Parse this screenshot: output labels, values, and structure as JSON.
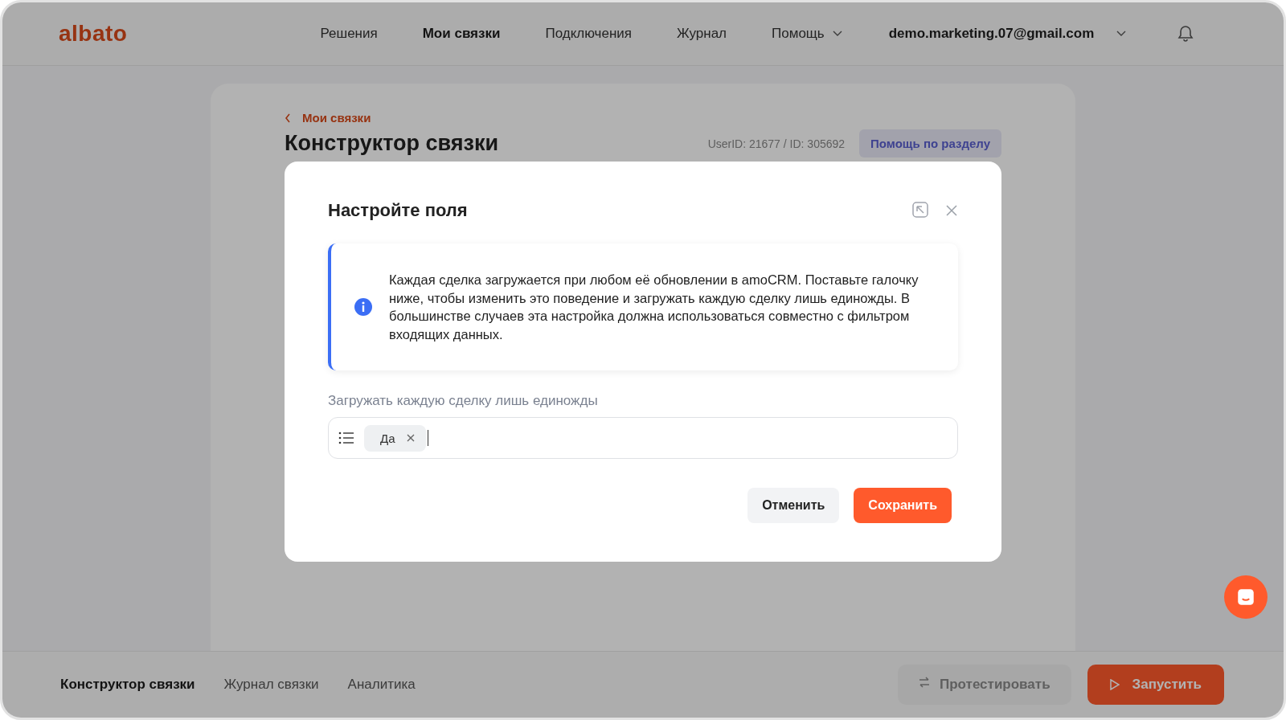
{
  "header": {
    "logo": "albato",
    "nav": [
      {
        "label": "Решения",
        "selected": false,
        "dropdown": false
      },
      {
        "label": "Мои связки",
        "selected": true,
        "dropdown": false
      },
      {
        "label": "Подключения",
        "selected": false,
        "dropdown": false
      },
      {
        "label": "Журнал",
        "selected": false,
        "dropdown": false
      },
      {
        "label": "Помощь",
        "selected": false,
        "dropdown": true
      }
    ],
    "account": "demo.marketing.07@gmail.com"
  },
  "page": {
    "back_link": "Мои связки",
    "title": "Конструктор связки",
    "ids": "UserID: 21677 / ID: 305692",
    "help_button": "Помощь по разделу"
  },
  "modal": {
    "title": "Настройте поля",
    "info": "Каждая сделка загружается при любом её обновлении в amoCRM. Поставьте галочку ниже, чтобы изменить это поведение и загружать каждую сделку лишь единожды. В большинстве случаев эта настройка должна использоваться совместно с фильтром входящих данных.",
    "field_label": "Загружать каждую сделку лишь единожды",
    "tags": [
      "Да"
    ],
    "cancel": "Отменить",
    "save": "Сохранить"
  },
  "bottom_bar": {
    "tabs": [
      {
        "label": "Конструктор связки",
        "selected": true
      },
      {
        "label": "Журнал связки",
        "selected": false
      },
      {
        "label": "Аналитика",
        "selected": false
      }
    ],
    "test_button": "Протестировать",
    "run_button": "Запустить"
  }
}
